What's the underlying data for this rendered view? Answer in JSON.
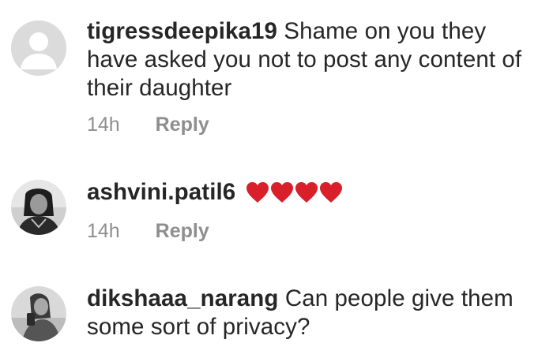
{
  "comments": [
    {
      "username": "tigressdeepika19",
      "text_lines": [
        " Shame on you they",
        "have asked you not to post any content of",
        "their daughter"
      ],
      "time": "14h",
      "reply_label": "Reply",
      "avatar": "default-avatar-icon"
    },
    {
      "username": "ashvini.patil6",
      "text_lines": [
        " "
      ],
      "hearts": [
        "red-heart-icon",
        "red-heart-icon",
        "red-heart-icon",
        "red-heart-icon"
      ],
      "time": "14h",
      "reply_label": "Reply",
      "avatar": "profile-photo"
    },
    {
      "username": "dikshaaa_narang",
      "text_lines": [
        " Can people give them",
        "some sort of privacy?"
      ],
      "avatar": "profile-photo"
    }
  ],
  "colors": {
    "text": "#262626",
    "meta": "#8e8e8e",
    "heart": "#d81f2a",
    "default_avatar_bg": "#dbdbdb"
  }
}
